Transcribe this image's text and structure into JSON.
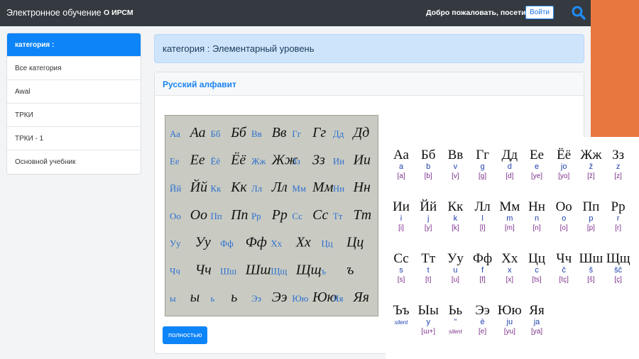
{
  "navbar": {
    "brand": "Электронное обучение",
    "link": "О ИРСМ",
    "welcome": "Добро пожаловать, посетитель",
    "login": "Войти"
  },
  "sidebar": {
    "items": [
      {
        "label": "категория :"
      },
      {
        "label": "Все категория"
      },
      {
        "label": "Awal"
      },
      {
        "label": "ТРКИ"
      },
      {
        "label": "ТРКИ - 1"
      },
      {
        "label": "Основной учебник"
      }
    ]
  },
  "category_title": "категория : Элементарный уровень",
  "card": {
    "title": "Русский алфавит",
    "button": "полностью"
  },
  "cursive_rows": [
    [
      "Аа",
      "Аа",
      "Бб",
      "Бб",
      "Вв",
      "Вв",
      "Гг",
      "Гг",
      "Дд",
      "Дд"
    ],
    [
      "Ее",
      "Ее",
      "Ёё",
      "Ёё",
      "Жж",
      "Жж",
      "Зз",
      "Зз",
      "Ии",
      "Ии"
    ],
    [
      "Йй",
      "Йй",
      "Кк",
      "Кк",
      "Лл",
      "Лл",
      "Мм",
      "Мм",
      "Нн",
      "Нн"
    ],
    [
      "Оо",
      "Оо",
      "Пп",
      "Пп",
      "Рр",
      "Рр",
      "Сс",
      "Сс",
      "Тт",
      "Тт"
    ],
    [
      "Уу",
      "Уу",
      "Фф",
      "Фф",
      "Хх",
      "Хх",
      "Цц",
      "Цц"
    ],
    [
      "Чч",
      "Чч",
      "Шш",
      "Шш",
      "Щщ",
      "Щщ",
      "ъ",
      "ъ"
    ],
    [
      "ы",
      "ы",
      "ь",
      "ь",
      "Ээ",
      "Ээ",
      "Юю",
      "Юю",
      "Яя",
      "Яя"
    ]
  ],
  "alphabet": [
    {
      "letter": "Аа",
      "tr": "a",
      "ipa": "[a]"
    },
    {
      "letter": "Бб",
      "tr": "b",
      "ipa": "[b]"
    },
    {
      "letter": "Вв",
      "tr": "v",
      "ipa": "[v]"
    },
    {
      "letter": "Гг",
      "tr": "g",
      "ipa": "[g]"
    },
    {
      "letter": "Дд",
      "tr": "d",
      "ipa": "[d]"
    },
    {
      "letter": "Ее",
      "tr": "e",
      "ipa": "[ye]"
    },
    {
      "letter": "Ёё",
      "tr": "jo",
      "ipa": "[yo]"
    },
    {
      "letter": "Жж",
      "tr": "ž",
      "ipa": "[ž]"
    },
    {
      "letter": "Зз",
      "tr": "z",
      "ipa": "[z]"
    },
    {
      "letter": "Ии",
      "tr": "i",
      "ipa": "[i]"
    },
    {
      "letter": "Йй",
      "tr": "j",
      "ipa": "[y]"
    },
    {
      "letter": "Кк",
      "tr": "k",
      "ipa": "[k]"
    },
    {
      "letter": "Лл",
      "tr": "l",
      "ipa": "[l]"
    },
    {
      "letter": "Мм",
      "tr": "m",
      "ipa": "[m]"
    },
    {
      "letter": "Нн",
      "tr": "n",
      "ipa": "[n]"
    },
    {
      "letter": "Оо",
      "tr": "o",
      "ipa": "[o]"
    },
    {
      "letter": "Пп",
      "tr": "p",
      "ipa": "[p]"
    },
    {
      "letter": "Рр",
      "tr": "r",
      "ipa": "[r]"
    },
    {
      "letter": "Сс",
      "tr": "s",
      "ipa": "[s]"
    },
    {
      "letter": "Тт",
      "tr": "t",
      "ipa": "[t]"
    },
    {
      "letter": "Уу",
      "tr": "u",
      "ipa": "[u]"
    },
    {
      "letter": "Фф",
      "tr": "f",
      "ipa": "[f]"
    },
    {
      "letter": "Хх",
      "tr": "x",
      "ipa": "[x]"
    },
    {
      "letter": "Цц",
      "tr": "c",
      "ipa": "[ts]"
    },
    {
      "letter": "Чч",
      "tr": "č",
      "ipa": "[tç]"
    },
    {
      "letter": "Шш",
      "tr": "š",
      "ipa": "[š]"
    },
    {
      "letter": "Щщ",
      "tr": "šč",
      "ipa": "[ç]"
    },
    {
      "letter": "Ъъ",
      "tr": "silent",
      "ipa": ""
    },
    {
      "letter": "Ыы",
      "tr": "y",
      "ipa": "[ɯ+]"
    },
    {
      "letter": "Ьь",
      "tr": "”",
      "ipa": "silent"
    },
    {
      "letter": "Ээ",
      "tr": "è",
      "ipa": "[e]"
    },
    {
      "letter": "Юю",
      "tr": "ju",
      "ipa": "[yu]"
    },
    {
      "letter": "Яя",
      "tr": "ja",
      "ipa": "[ya]"
    }
  ],
  "colors": {
    "navbar": "#343a40",
    "accent": "#0d84f7",
    "orange": "#e8773f",
    "category_bg": "#cde4fb"
  }
}
